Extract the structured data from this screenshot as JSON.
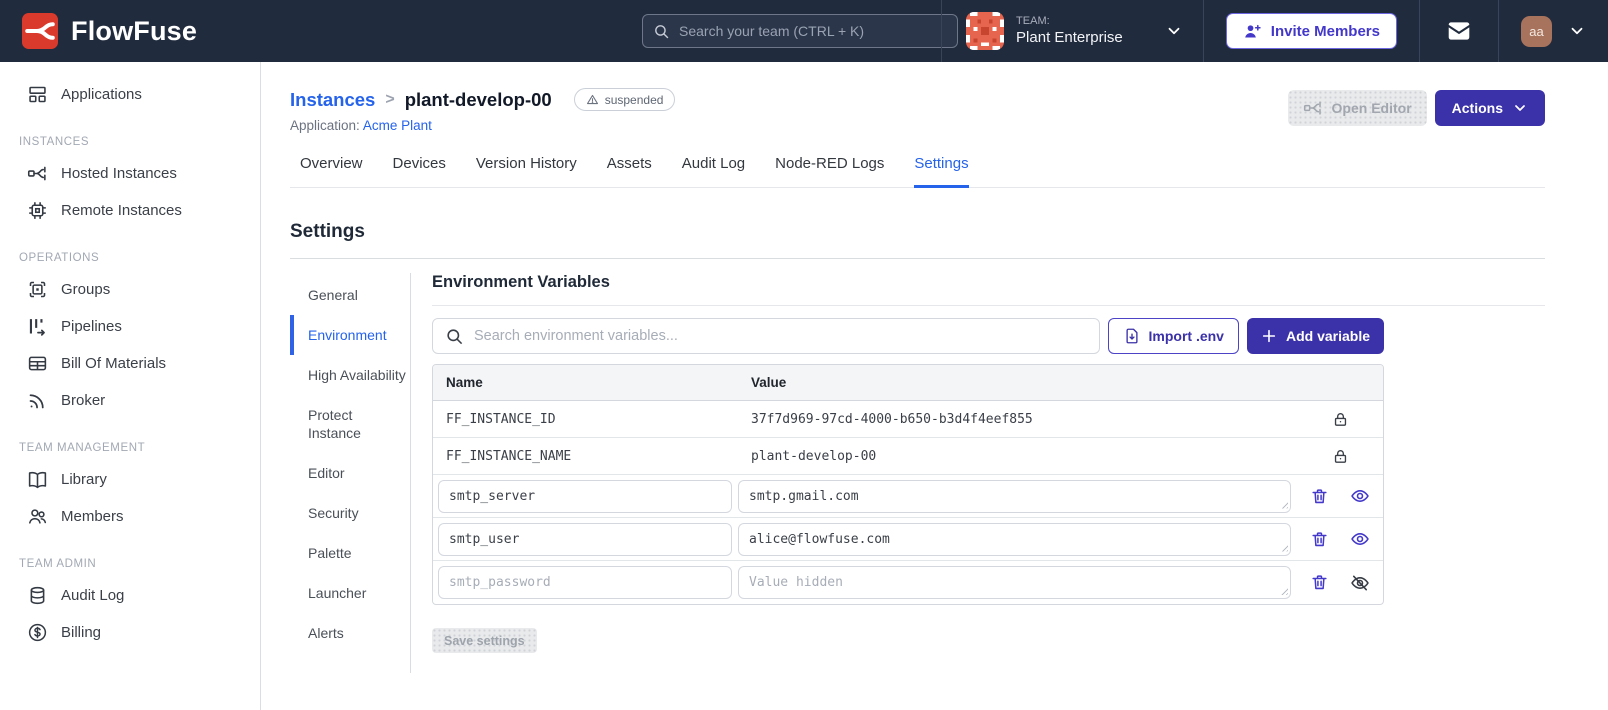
{
  "navbar": {
    "brand": "FlowFuse",
    "search_placeholder": "Search your team (CTRL + K)",
    "team_label": "TEAM:",
    "team_name": "Plant Enterprise",
    "invite_members_label": "Invite Members",
    "avatar_initials": "aa"
  },
  "sidebar": {
    "headers": [
      "INSTANCES",
      "OPERATIONS",
      "TEAM MANAGEMENT",
      "TEAM ADMIN"
    ],
    "items": [
      {
        "label": "Applications"
      },
      {
        "label": "Hosted Instances"
      },
      {
        "label": "Remote Instances"
      },
      {
        "label": "Groups"
      },
      {
        "label": "Pipelines"
      },
      {
        "label": "Bill Of Materials"
      },
      {
        "label": "Broker"
      },
      {
        "label": "Library"
      },
      {
        "label": "Members"
      },
      {
        "label": "Audit Log"
      },
      {
        "label": "Billing"
      }
    ]
  },
  "page_header": {
    "breadcrumb_parent": "Instances",
    "breadcrumb_separator": ">",
    "instance_name": "plant-develop-00",
    "status_badge": "suspended",
    "application_label": "Application:",
    "application_name": "Acme Plant",
    "open_editor_label": "Open Editor",
    "actions_label": "Actions"
  },
  "tabs": {
    "items": [
      "Overview",
      "Devices",
      "Version History",
      "Assets",
      "Audit Log",
      "Node-RED Logs",
      "Settings"
    ],
    "active": "Settings"
  },
  "settings": {
    "title": "Settings",
    "nav": [
      "General",
      "Environment",
      "High Availability",
      "Protect Instance",
      "Editor",
      "Security",
      "Palette",
      "Launcher",
      "Alerts"
    ],
    "active": "Environment"
  },
  "environment": {
    "title": "Environment Variables",
    "search_placeholder": "Search environment variables...",
    "import_button": "Import .env",
    "add_button": "Add variable",
    "save_button": "Save settings",
    "table": {
      "columns": [
        "Name",
        "Value"
      ],
      "locked_rows": [
        {
          "name": "FF_INSTANCE_ID",
          "value": "37f7d969-97cd-4000-b650-b3d4f4eef855"
        },
        {
          "name": "FF_INSTANCE_NAME",
          "value": "plant-develop-00"
        }
      ],
      "editable_rows": [
        {
          "name": "smtp_server",
          "value": "smtp.gmail.com",
          "hidden": false
        },
        {
          "name": "smtp_user",
          "value": "alice@flowfuse.com",
          "hidden": false
        },
        {
          "name": "smtp_password",
          "value": "",
          "value_placeholder": "Value hidden",
          "hidden": true
        }
      ]
    }
  },
  "colors": {
    "navbar_bg": "#212B3E",
    "brand_red": "#DA3A2B",
    "primary_indigo": "#3B31A8",
    "link_blue": "#2563EB",
    "team_avatar_orange": "#E5654E",
    "user_avatar_brown": "#A8735C",
    "disabled_gray": "#E9EAEC"
  }
}
